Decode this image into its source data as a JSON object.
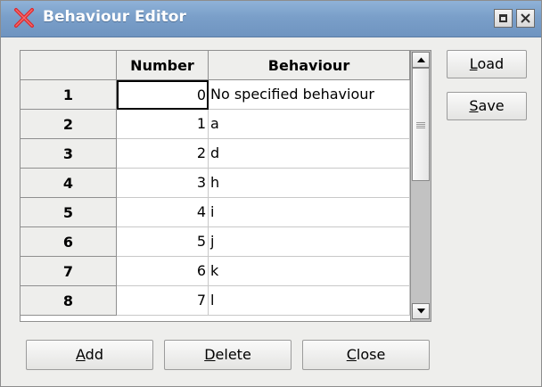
{
  "window": {
    "title": "Behaviour Editor",
    "close_icon": "x-close-icon",
    "maximize_icon": "maximize-icon"
  },
  "table": {
    "columns": [
      "",
      "Number",
      "Behaviour"
    ],
    "rows": [
      {
        "index": "1",
        "number": "0",
        "behaviour": "No specified behaviour"
      },
      {
        "index": "2",
        "number": "1",
        "behaviour": "a"
      },
      {
        "index": "3",
        "number": "2",
        "behaviour": "d"
      },
      {
        "index": "4",
        "number": "3",
        "behaviour": "h"
      },
      {
        "index": "5",
        "number": "4",
        "behaviour": "i"
      },
      {
        "index": "6",
        "number": "5",
        "behaviour": "j"
      },
      {
        "index": "7",
        "number": "6",
        "behaviour": "k"
      },
      {
        "index": "8",
        "number": "7",
        "behaviour": "l"
      }
    ]
  },
  "buttons": {
    "load": {
      "mnemonic": "L",
      "rest": "oad"
    },
    "save": {
      "mnemonic": "S",
      "rest": "ave"
    },
    "add": {
      "mnemonic": "A",
      "rest": "dd"
    },
    "delete": {
      "mnemonic": "D",
      "rest": "elete"
    },
    "close": {
      "mnemonic": "C",
      "rest": "lose"
    }
  },
  "colors": {
    "titlebar": "#7a9fc9",
    "title_x_icon": "#e0262b",
    "window_bg": "#eeeeec"
  }
}
